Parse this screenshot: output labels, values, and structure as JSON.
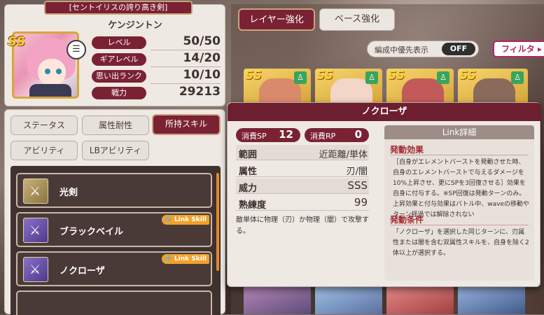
{
  "character": {
    "title": "[セントイリスの誇り高き剣]",
    "name": "ケンジントン",
    "rarity": "SS",
    "stats": [
      {
        "label": "レベル",
        "value": "50/50"
      },
      {
        "label": "ギアレベル",
        "value": "14/20"
      },
      {
        "label": "思い出ランク",
        "value": "10/10"
      },
      {
        "label": "戦力",
        "value": "29213"
      }
    ]
  },
  "tabs": {
    "row1": [
      "ステータス",
      "属性耐性",
      "所持スキル"
    ],
    "row2": [
      "アビリティ",
      "LBアビリティ"
    ],
    "active": "所持スキル"
  },
  "skills": [
    {
      "name": "光剣",
      "link": ""
    },
    {
      "name": "ブラックベイル",
      "link": "Link Skill"
    },
    {
      "name": "ノクローザ",
      "link": "Link Skill"
    }
  ],
  "party": {
    "modes": [
      "レイヤー強化",
      "ベース強化"
    ],
    "priority_label": "編成中優先表示",
    "priority_state": "OFF",
    "filter_label": "フィルタ"
  },
  "popup": {
    "title": "ノクローザ",
    "sp_label": "消費SP",
    "sp_value": "12",
    "rp_label": "消費RP",
    "rp_value": "0",
    "rows": [
      {
        "k": "範囲",
        "v": "近距離/単体"
      },
      {
        "k": "属性",
        "v": "刃/闇"
      },
      {
        "k": "威力",
        "v": "SSS"
      },
      {
        "k": "熟練度",
        "v": "99"
      }
    ],
    "description": "敵単体に物理（刃）か物理（闇）で攻撃する。",
    "link_title": "Link詳細",
    "effect_title": "発動効果",
    "effect_body": "［自身がエレメントバーストを発動させた時、自身のエレメントバーストで与えるダメージを10%上昇させ、更にSPを3回復させる］効果を自身に付与する。※SP回復は発動ターンのみ。上昇効果と付与効果はバトル中、waveの移動やターン経過では解除されない",
    "condition_title": "発動条件",
    "condition_body": "「ノクローザ」を選択した同じターンに、刃属性または闇を含む双属性スキルを、自身を除く2体以上が選択する。"
  }
}
